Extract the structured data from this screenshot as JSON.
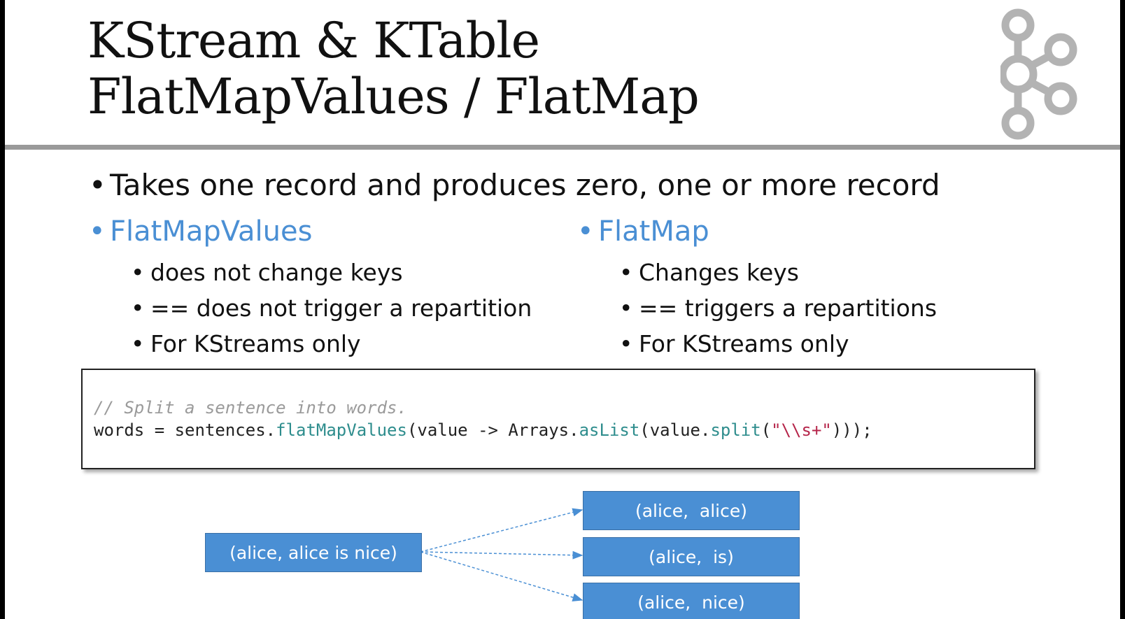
{
  "slide": {
    "title_line1": "KStream & KTable",
    "title_line2": "FlatMapValues / FlatMap",
    "logo_icon": "kafka-logo-icon",
    "main_bullet": "Takes one record and produces zero, one or more record",
    "left": {
      "heading": "FlatMapValues",
      "items": [
        "does not change keys",
        "== does not trigger a repartition",
        "For KStreams only"
      ]
    },
    "right": {
      "heading": "FlatMap",
      "items": [
        "Changes keys",
        "== triggers a repartitions",
        "For KStreams only"
      ]
    },
    "code": {
      "comment": "// Split a sentence into words.",
      "p1": "words = sentences.",
      "m1": "flatMapValues",
      "p2": "(value -> Arrays.",
      "m2": "asList",
      "p3": "(value.",
      "m3": "split",
      "p4": "(",
      "str": "\"\\\\s+\"",
      "p5": ")));"
    },
    "diagram": {
      "source": "(alice, alice is nice)",
      "outputs": [
        "(alice,  alice)",
        "(alice,  is)",
        "(alice,  nice)"
      ]
    },
    "colors": {
      "accent": "#4a8fd4",
      "rule": "#9a9a9a",
      "logo": "#b3b3b3"
    }
  }
}
